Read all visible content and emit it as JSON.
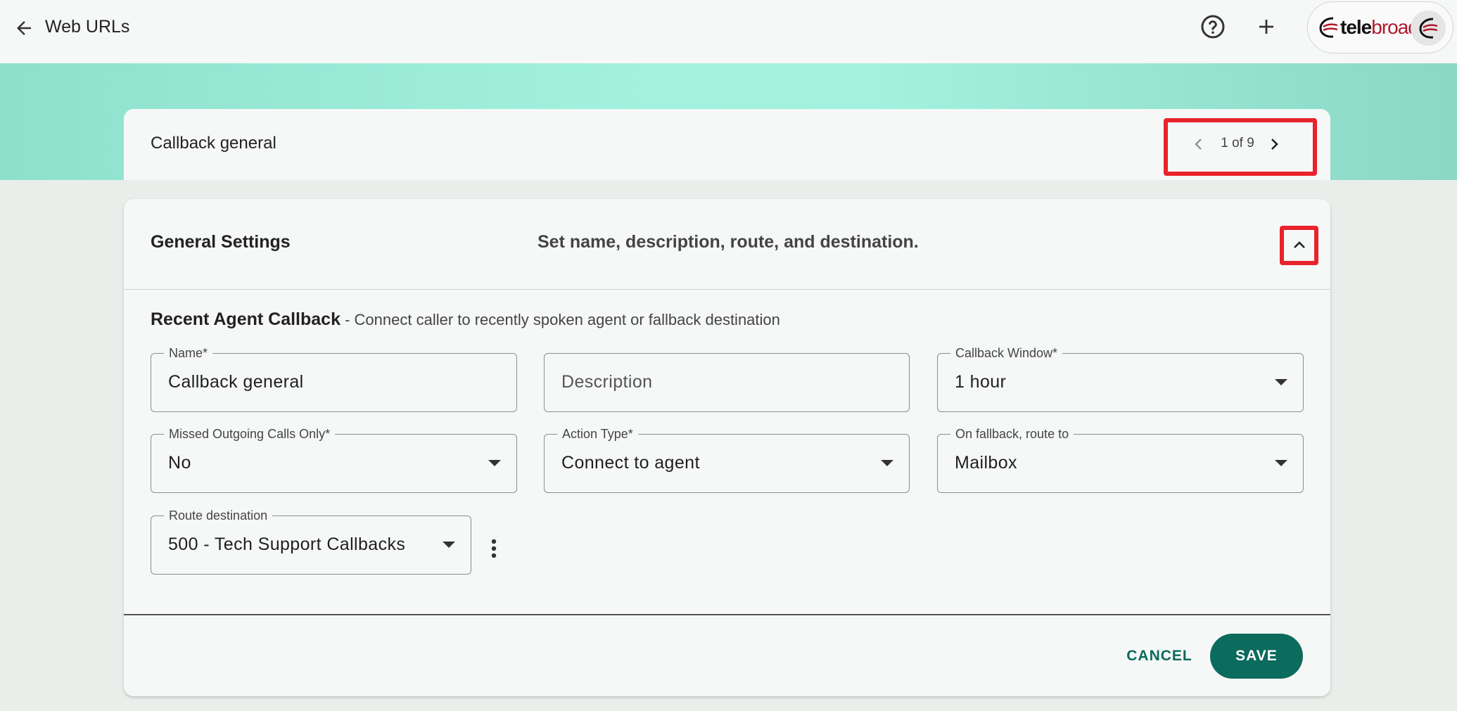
{
  "appbar": {
    "title": "Web URLs",
    "back_icon": "arrow-left-icon",
    "help_icon": "help-circle-icon",
    "add_icon": "plus-icon",
    "brand": {
      "tele": "tele",
      "broad": "broad"
    }
  },
  "header": {
    "record_title": "Callback general",
    "pager": {
      "current": 1,
      "total": 9,
      "label": "1 of 9"
    }
  },
  "section": {
    "title": "General Settings",
    "subtitle": "Set name, description, route, and destination.",
    "feature_name": "Recent Agent Callback",
    "feature_desc": " - Connect caller to recently spoken agent or fallback destination"
  },
  "fields": {
    "name": {
      "label": "Name*",
      "value": "Callback general"
    },
    "description": {
      "placeholder": "Description"
    },
    "callback_window": {
      "label": "Callback Window*",
      "value": "1 hour"
    },
    "missed_outgoing": {
      "label": "Missed Outgoing Calls Only*",
      "value": "No"
    },
    "action_type": {
      "label": "Action Type*",
      "value": "Connect to agent"
    },
    "fallback_route": {
      "label": "On fallback, route to",
      "value": "Mailbox"
    },
    "route_destination": {
      "label": "Route destination",
      "value": "500 - Tech Support Callbacks"
    }
  },
  "actions": {
    "cancel_label": "CANCEL",
    "save_label": "SAVE"
  },
  "colors": {
    "accent": "#0b6b5c",
    "highlight": "#e8232b",
    "teal_band": "#a3f2df"
  }
}
